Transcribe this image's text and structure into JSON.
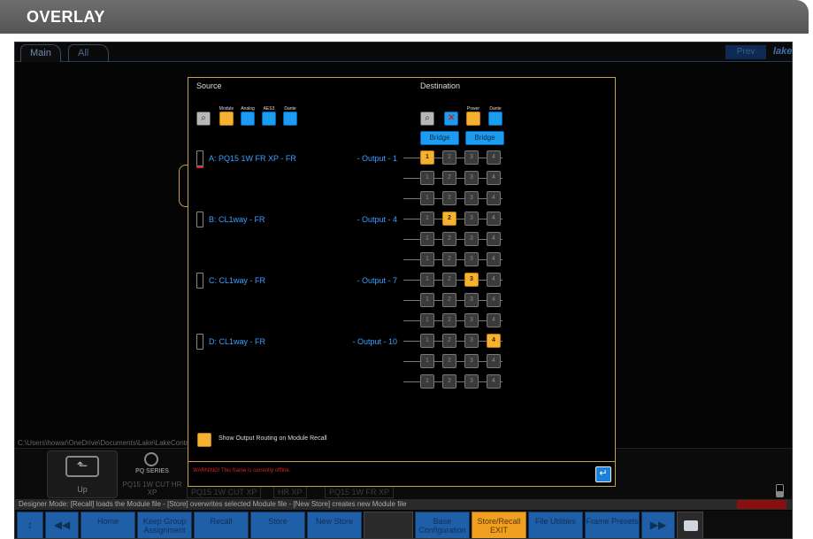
{
  "page": {
    "title": "OVERLAY"
  },
  "tabs": [
    {
      "label": "Main"
    },
    {
      "label": "All"
    }
  ],
  "header": {
    "preview_label": "Prev",
    "logo_text": "lake"
  },
  "path_text": "C:\\Users\\howar\\OneDrive\\Documents\\Lake\\LakeController",
  "dialog": {
    "source_heading": "Source",
    "destination_heading": "Destination",
    "source_filters": [
      {
        "label": "Module",
        "color": "#f5b130"
      },
      {
        "label": "Analog",
        "color": "#1c9cf0"
      },
      {
        "label": "AES3",
        "color": "#1c9cf0"
      },
      {
        "label": "Dante",
        "color": "#1c9cf0"
      }
    ],
    "dest_filters": [
      {
        "label": "",
        "color": "#1c9cf0",
        "icon": "crossed-out-icon"
      },
      {
        "label": "Power",
        "color": "#f5b130"
      },
      {
        "label": "Dante",
        "color": "#1c9cf0"
      }
    ],
    "bridge_labels": [
      "Bridge",
      "Bridge"
    ],
    "sources": [
      {
        "label": "A: PQ15 1W FR XP - FR",
        "output": "- Output - 1",
        "marked": true
      },
      {
        "label": "B: CL1way - FR",
        "output": "- Output - 4",
        "marked": false
      },
      {
        "label": "C: CL1way - FR",
        "output": "- Output - 7",
        "marked": false
      },
      {
        "label": "D: CL1way - FR",
        "output": "- Output - 10",
        "marked": false
      }
    ],
    "route_rows": [
      {
        "nodes": [
          "1",
          "2",
          "3",
          "4"
        ],
        "active": 0
      },
      {
        "nodes": [
          "1",
          "2",
          "3",
          "4"
        ],
        "active": -1
      },
      {
        "nodes": [
          "1",
          "2",
          "3",
          "4"
        ],
        "active": -1
      },
      {
        "nodes": [
          "1",
          "2",
          "3",
          "4"
        ],
        "active": 1
      },
      {
        "nodes": [
          "1",
          "2",
          "3",
          "4"
        ],
        "active": -1
      },
      {
        "nodes": [
          "1",
          "2",
          "3",
          "4"
        ],
        "active": -1
      },
      {
        "nodes": [
          "1",
          "2",
          "3",
          "4"
        ],
        "active": 2
      },
      {
        "nodes": [
          "1",
          "2",
          "3",
          "4"
        ],
        "active": -1
      },
      {
        "nodes": [
          "1",
          "2",
          "3",
          "4"
        ],
        "active": -1
      },
      {
        "nodes": [
          "1",
          "2",
          "3",
          "4"
        ],
        "active": 3
      },
      {
        "nodes": [
          "1",
          "2",
          "3",
          "4"
        ],
        "active": -1
      },
      {
        "nodes": [
          "1",
          "2",
          "3",
          "4"
        ],
        "active": -1
      }
    ],
    "show_routing_label": "Show Output Routing on Module Recall",
    "show_routing_checked": true,
    "warning": "WARNING! This frame is currently offline."
  },
  "module_strip": {
    "up_label": "Up",
    "pq_series": "PQ SERIES",
    "pq_name": "PQ15 1W CUT HR XP",
    "items": [
      "PQ15 1W CUT XP",
      "HR XP",
      "PQ15 1W FR XP"
    ]
  },
  "status": "Designer Mode: [Recall] loads the Module file - [Store] overwrites selected Module file - [New Store] creates new Module file",
  "function_keys": [
    {
      "label": "↕",
      "style": "arrow"
    },
    {
      "label": "◀◀",
      "style": "arrow"
    },
    {
      "label": "Home",
      "style": "blue"
    },
    {
      "label": "Keep Group Assignment",
      "style": "blue"
    },
    {
      "label": "Recall",
      "style": "blue"
    },
    {
      "label": "Store",
      "style": "blue"
    },
    {
      "label": "New Store",
      "style": "blue"
    },
    {
      "label": "",
      "style": "dark"
    },
    {
      "label": "Base Configuration",
      "style": "blue"
    },
    {
      "label": "Store/Recall EXIT",
      "style": "orange"
    },
    {
      "label": "File Utilities",
      "style": "blue"
    },
    {
      "label": "Frame Presets",
      "style": "blue"
    },
    {
      "label": "▶▶",
      "style": "arrow"
    },
    {
      "label": "",
      "style": "camera"
    }
  ]
}
